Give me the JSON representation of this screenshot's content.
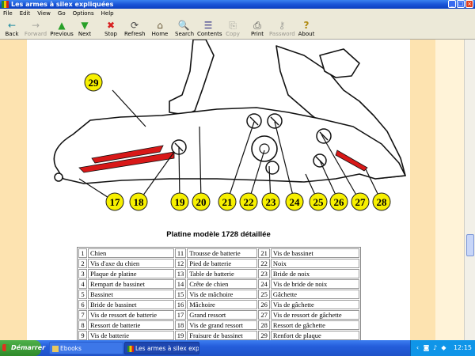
{
  "window": {
    "title": "Les armes à silex expliquées",
    "controls": [
      "_",
      "□",
      "×"
    ]
  },
  "menu": [
    "File",
    "Edit",
    "View",
    "Go",
    "Options",
    "Help"
  ],
  "toolbar": [
    {
      "label": "Back",
      "icon": "←",
      "enabled": true
    },
    {
      "label": "Forward",
      "icon": "→",
      "enabled": false
    },
    {
      "label": "Previous",
      "icon": "▲",
      "enabled": true
    },
    {
      "label": "Next",
      "icon": "▼",
      "enabled": true
    },
    {
      "label": "Stop",
      "icon": "✖",
      "enabled": true
    },
    {
      "label": "Refresh",
      "icon": "⟳",
      "enabled": true
    },
    {
      "label": "Home",
      "icon": "⌂",
      "enabled": true
    },
    {
      "label": "Search",
      "icon": "🔍",
      "enabled": true
    },
    {
      "label": "Contents",
      "icon": "☰",
      "enabled": true
    },
    {
      "label": "Copy",
      "icon": "⎘",
      "enabled": false
    },
    {
      "label": "Print",
      "icon": "⎙",
      "enabled": true
    },
    {
      "label": "Password",
      "icon": "⚷",
      "enabled": false
    },
    {
      "label": "About",
      "icon": "?",
      "enabled": true
    }
  ],
  "diagram": {
    "callouts": [
      "29",
      "17",
      "18",
      "19",
      "20",
      "21",
      "22",
      "23",
      "24",
      "25",
      "26",
      "27",
      "28"
    ]
  },
  "caption": "Platine modèle 1728 détaillée",
  "parts": [
    {
      "n": "1",
      "name": "Chien"
    },
    {
      "n": "2",
      "name": "Vis d'axe du chien"
    },
    {
      "n": "3",
      "name": "Plaque de platine"
    },
    {
      "n": "4",
      "name": "Rempart de bassinet"
    },
    {
      "n": "5",
      "name": "Bassinet"
    },
    {
      "n": "6",
      "name": "Bride de bassinet"
    },
    {
      "n": "7",
      "name": "Vis de ressort de batterie"
    },
    {
      "n": "8",
      "name": "Ressort de batterie"
    },
    {
      "n": "9",
      "name": "Vis de batterie"
    },
    {
      "n": "11",
      "name": "Trousse de batterie"
    },
    {
      "n": "12",
      "name": "Pied de batterie"
    },
    {
      "n": "13",
      "name": "Table de batterie"
    },
    {
      "n": "14",
      "name": "Crête de chien"
    },
    {
      "n": "15",
      "name": "Vis de mâchoire"
    },
    {
      "n": "16",
      "name": "Mâchoire"
    },
    {
      "n": "17",
      "name": "Grand ressort"
    },
    {
      "n": "18",
      "name": "Vis de grand ressort"
    },
    {
      "n": "19",
      "name": "Fraisure de bassinet"
    },
    {
      "n": "21",
      "name": "Vis de bassinet"
    },
    {
      "n": "22",
      "name": "Noix"
    },
    {
      "n": "23",
      "name": "Bride de noix"
    },
    {
      "n": "24",
      "name": "Vis de bride de noix"
    },
    {
      "n": "25",
      "name": "Gâchette"
    },
    {
      "n": "26",
      "name": "Vis de gâchette"
    },
    {
      "n": "27",
      "name": "Vis de ressort de gâchette"
    },
    {
      "n": "28",
      "name": "Ressort de gâchette"
    },
    {
      "n": "29",
      "name": "Renfort de plaque"
    }
  ],
  "taskbar": {
    "start": "Démarrer",
    "tasks": [
      "Ebooks",
      "Les armes à silex expl..."
    ],
    "clock": "12:15"
  },
  "colors": {
    "callout_fill": "#f7f000",
    "spring_red": "#d81818",
    "page_band": "#fde3b0"
  }
}
